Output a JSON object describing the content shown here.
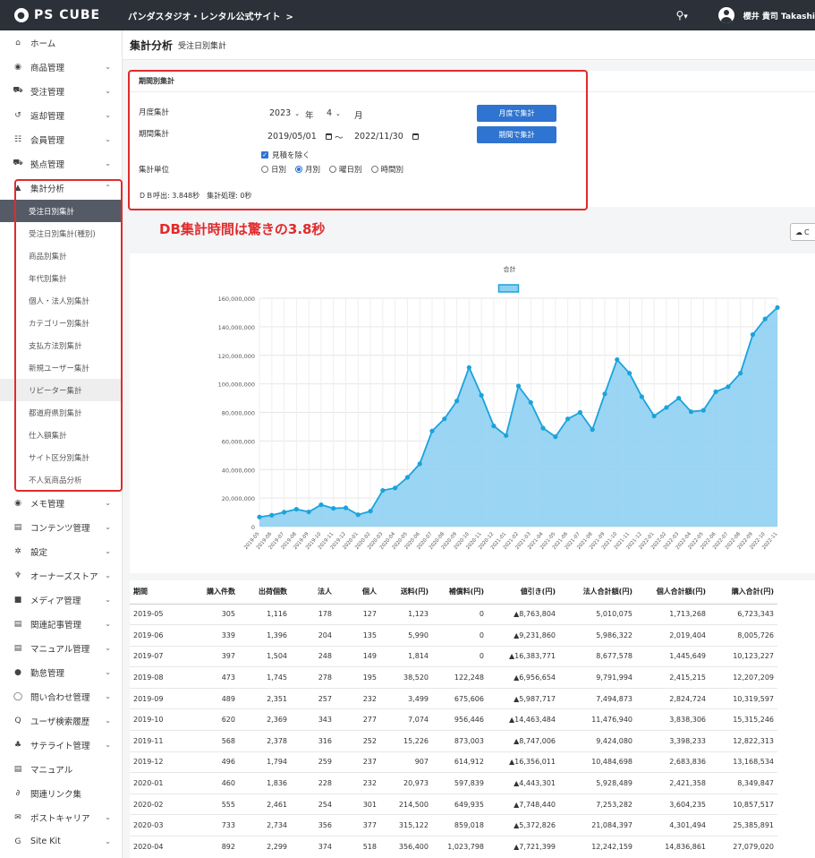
{
  "topbar": {
    "logo_text": "PS CUBE",
    "site_title": "パンダスタジオ・レンタル公式サイト",
    "site_chevron": ">",
    "search_caret": "▾",
    "user_name": "櫻井 貴司 Takashi"
  },
  "sidebar": {
    "items_top": [
      {
        "icon": "⌂",
        "label": "ホーム",
        "chevron": ""
      },
      {
        "icon": "◉",
        "label": "商品管理",
        "chevron": "⌄"
      },
      {
        "icon": "⛟",
        "label": "受注管理",
        "chevron": "⌄"
      },
      {
        "icon": "↺",
        "label": "返却管理",
        "chevron": "⌄"
      },
      {
        "icon": "☷",
        "label": "会員管理",
        "chevron": "⌄"
      },
      {
        "icon": "⛟",
        "label": "拠点管理",
        "chevron": "⌄"
      },
      {
        "icon": "▲",
        "label": "集計分析",
        "chevron": "⌃"
      }
    ],
    "sub_items": [
      {
        "label": "受注日別集計",
        "state": "active"
      },
      {
        "label": "受注日別集計(種別)",
        "state": ""
      },
      {
        "label": "商品別集計",
        "state": ""
      },
      {
        "label": "年代別集計",
        "state": ""
      },
      {
        "label": "個人・法人別集計",
        "state": ""
      },
      {
        "label": "カテゴリー別集計",
        "state": ""
      },
      {
        "label": "支払方法別集計",
        "state": ""
      },
      {
        "label": "新規ユーザー集計",
        "state": ""
      },
      {
        "label": "リピーター集計",
        "state": "hover"
      },
      {
        "label": "都道府県別集計",
        "state": ""
      },
      {
        "label": "仕入額集計",
        "state": ""
      },
      {
        "label": "サイト区分別集計",
        "state": ""
      },
      {
        "label": "不人気商品分析",
        "state": ""
      }
    ],
    "items_bottom": [
      {
        "icon": "◉",
        "label": "メモ管理",
        "chevron": "⌄"
      },
      {
        "icon": "▤",
        "label": "コンテンツ管理",
        "chevron": "⌄"
      },
      {
        "icon": "✲",
        "label": "設定",
        "chevron": "⌄"
      },
      {
        "icon": "♆",
        "label": "オーナーズストア",
        "chevron": "⌄"
      },
      {
        "icon": "■",
        "label": "メディア管理",
        "chevron": "⌄"
      },
      {
        "icon": "▤",
        "label": "関連記事管理",
        "chevron": "⌄"
      },
      {
        "icon": "▤",
        "label": "マニュアル管理",
        "chevron": "⌄"
      },
      {
        "icon": "●",
        "label": "勤怠管理",
        "chevron": "⌄"
      },
      {
        "icon": "◯",
        "label": "問い合わせ管理",
        "chevron": "⌄"
      },
      {
        "icon": "Q",
        "label": "ユーザ検索履歴",
        "chevron": "⌄"
      },
      {
        "icon": "♣",
        "label": "サテライト管理",
        "chevron": "⌄"
      },
      {
        "icon": "▤",
        "label": "マニュアル",
        "chevron": ""
      },
      {
        "icon": "∂",
        "label": "関連リンク集",
        "chevron": ""
      },
      {
        "icon": "✉",
        "label": "ポストキャリア",
        "chevron": "⌄"
      },
      {
        "icon": "G",
        "label": "Site Kit",
        "chevron": "⌄"
      }
    ]
  },
  "header": {
    "title": "集計分析",
    "subtitle": "受注日別集計"
  },
  "filter": {
    "heading": "期間別集計",
    "monthly_label": "月度集計",
    "year_value": "2023",
    "year_unit": "年",
    "month_value": "4",
    "month_unit": "月",
    "monthly_button": "月度で集計",
    "period_label": "期間集計",
    "date_from": "2019/05/01",
    "tilde": "〜",
    "date_to": "2022/11/30",
    "period_button": "期間で集計",
    "exclude_label": "見積を除く",
    "exclude_checked": true,
    "unit_label": "集計単位",
    "unit_options": [
      "日別",
      "月別",
      "曜日別",
      "時間別"
    ],
    "unit_selected": "月別",
    "timing_text": "ＤＢ呼出: 3.848秒　集計処理: 0秒"
  },
  "annotation": "DB集計時間は驚きの3.8秒",
  "csv_button": "C",
  "chart_data": {
    "type": "area",
    "series": [
      {
        "name": "合計",
        "values": [
          6723343,
          8005726,
          10123227,
          12207209,
          10319597,
          15315246,
          12822313,
          13168534,
          8349847,
          10857517,
          25385891,
          27079020,
          34500000,
          44000000,
          67000000,
          75500000,
          88000000,
          111500000,
          92000000,
          70500000,
          63800000,
          98500000,
          87000000,
          69000000,
          63000000,
          75500000,
          80000000,
          68000000,
          93000000,
          117000000,
          107500000,
          91000000,
          77500000,
          83500000,
          90000000,
          80500000,
          81500000,
          94500000,
          98000000,
          107500000,
          134500000,
          145500000,
          153500000
        ]
      }
    ],
    "x": [
      "2019-05",
      "2019-06",
      "2019-07",
      "2019-08",
      "2019-09",
      "2019-10",
      "2019-11",
      "2019-12",
      "2020-01",
      "2020-02",
      "2020-03",
      "2020-04",
      "2020-05",
      "2020-06",
      "2020-07",
      "2020-08",
      "2020-09",
      "2020-10",
      "2020-11",
      "2020-12",
      "2021-01",
      "2021-02",
      "2021-03",
      "2021-04",
      "2021-05",
      "2021-06",
      "2021-07",
      "2021-08",
      "2021-09",
      "2021-10",
      "2021-11",
      "2021-12",
      "2022-01",
      "2022-02",
      "2022-03",
      "2022-04",
      "2022-05",
      "2022-06",
      "2022-07",
      "2022-08",
      "2022-09",
      "2022-10",
      "2022-11"
    ],
    "yticks": [
      "0",
      "20,000,000",
      "40,000,000",
      "60,000,000",
      "80,000,000",
      "100,000,000",
      "120,000,000",
      "140,000,000",
      "160,000,000"
    ],
    "ylim": [
      0,
      160000000
    ],
    "grid": true,
    "legend": "top-center",
    "line_color": "#1aa3dc",
    "fill_color": "#8fd0f2"
  },
  "table": {
    "columns": [
      "期間",
      "購入件数",
      "出荷個数",
      "法人",
      "個人",
      "送料(円)",
      "補償料(円)",
      "値引き(円)",
      "法人合計額(円)",
      "個人合計額(円)",
      "購入合計(円)"
    ],
    "rows": [
      [
        "2019-05",
        "305",
        "1,116",
        "178",
        "127",
        "1,123",
        "0",
        "▲8,763,804",
        "5,010,075",
        "1,713,268",
        "6,723,343"
      ],
      [
        "2019-06",
        "339",
        "1,396",
        "204",
        "135",
        "5,990",
        "0",
        "▲9,231,860",
        "5,986,322",
        "2,019,404",
        "8,005,726"
      ],
      [
        "2019-07",
        "397",
        "1,504",
        "248",
        "149",
        "1,814",
        "0",
        "▲16,383,771",
        "8,677,578",
        "1,445,649",
        "10,123,227"
      ],
      [
        "2019-08",
        "473",
        "1,745",
        "278",
        "195",
        "38,520",
        "122,248",
        "▲6,956,654",
        "9,791,994",
        "2,415,215",
        "12,207,209"
      ],
      [
        "2019-09",
        "489",
        "2,351",
        "257",
        "232",
        "3,499",
        "675,606",
        "▲5,987,717",
        "7,494,873",
        "2,824,724",
        "10,319,597"
      ],
      [
        "2019-10",
        "620",
        "2,369",
        "343",
        "277",
        "7,074",
        "956,446",
        "▲14,463,484",
        "11,476,940",
        "3,838,306",
        "15,315,246"
      ],
      [
        "2019-11",
        "568",
        "2,378",
        "316",
        "252",
        "15,226",
        "873,003",
        "▲8,747,006",
        "9,424,080",
        "3,398,233",
        "12,822,313"
      ],
      [
        "2019-12",
        "496",
        "1,794",
        "259",
        "237",
        "907",
        "614,912",
        "▲16,356,011",
        "10,484,698",
        "2,683,836",
        "13,168,534"
      ],
      [
        "2020-01",
        "460",
        "1,836",
        "228",
        "232",
        "20,973",
        "597,839",
        "▲4,443,301",
        "5,928,489",
        "2,421,358",
        "8,349,847"
      ],
      [
        "2020-02",
        "555",
        "2,461",
        "254",
        "301",
        "214,500",
        "649,935",
        "▲7,748,440",
        "7,253,282",
        "3,604,235",
        "10,857,517"
      ],
      [
        "2020-03",
        "733",
        "2,734",
        "356",
        "377",
        "315,122",
        "859,018",
        "▲5,372,826",
        "21,084,397",
        "4,301,494",
        "25,385,891"
      ],
      [
        "2020-04",
        "892",
        "2,299",
        "374",
        "518",
        "356,400",
        "1,023,798",
        "▲7,721,399",
        "12,242,159",
        "14,836,861",
        "27,079,020"
      ]
    ]
  }
}
